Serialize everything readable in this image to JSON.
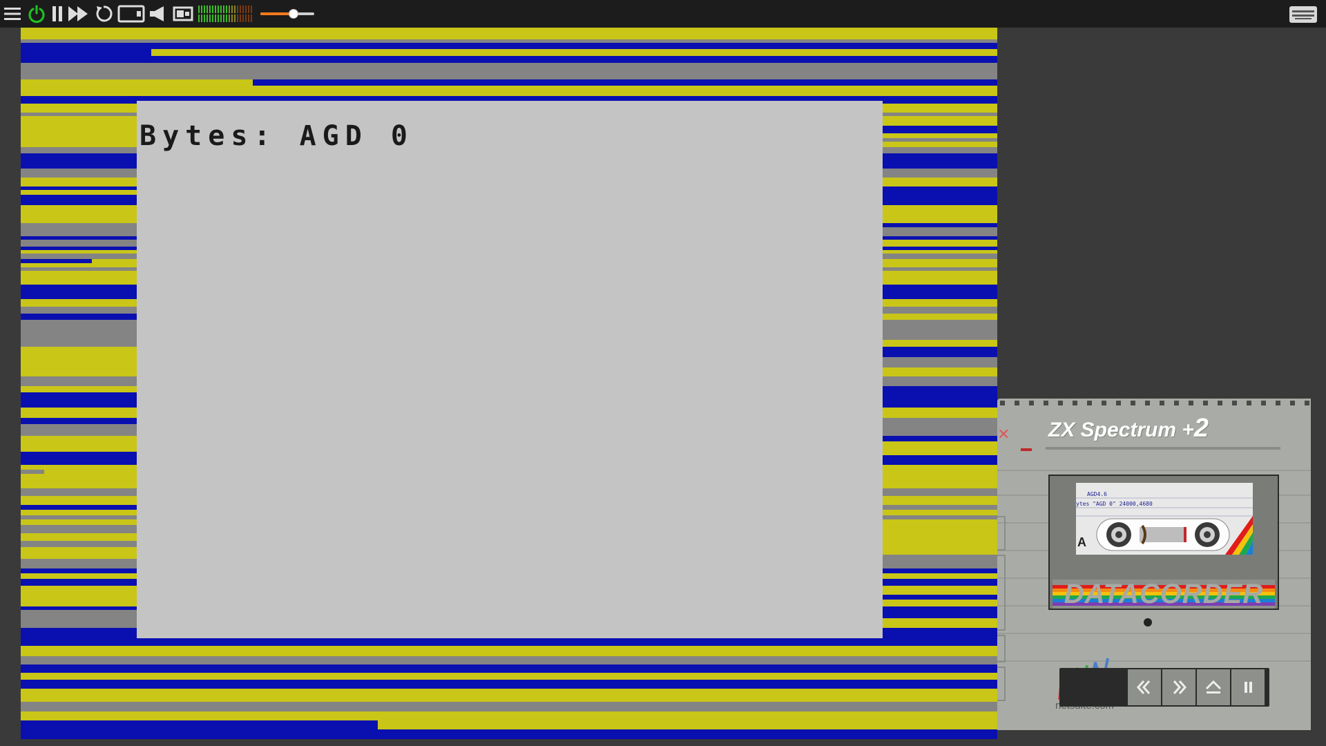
{
  "toolbar": {
    "buttons": [
      {
        "name": "menu-icon"
      },
      {
        "name": "power-icon",
        "color": "#21c021"
      },
      {
        "name": "pause-icon"
      },
      {
        "name": "fast-forward-icon"
      },
      {
        "name": "reset-icon"
      },
      {
        "name": "tape-icon"
      },
      {
        "name": "mute-icon"
      },
      {
        "name": "display-icon"
      }
    ],
    "volume_level": 0.62,
    "accent_color": "#ff7a1a"
  },
  "screen": {
    "text": "Bytes: AGD 0",
    "border_colors": [
      "#0a10b0",
      "#c9c618",
      "#848484"
    ],
    "paper_color": "#c4c4c4"
  },
  "tape": {
    "title_prefix": "ZX Spectrum +",
    "title_suffix": "2",
    "cassette_label_line1": "AGD4.6",
    "cassette_label_line2": "ytes \"AGD 0\" 24000,4680",
    "cassette_side": "A",
    "brand": "DATACORDER",
    "brand_site": "netsuite.com",
    "transport_buttons": [
      "rewind-icon",
      "forward-icon",
      "eject-icon",
      "pause-icon"
    ]
  }
}
